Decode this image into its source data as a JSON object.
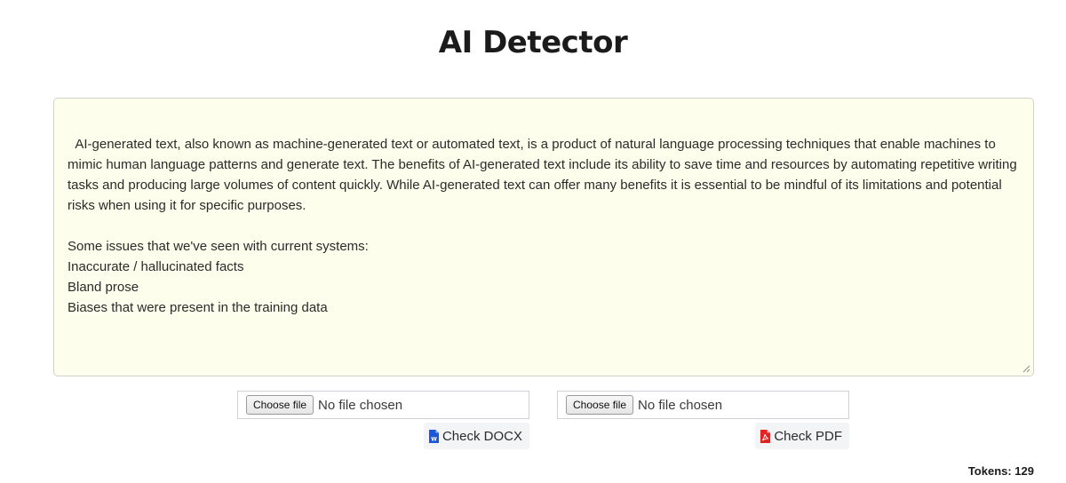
{
  "page": {
    "title": "AI Detector"
  },
  "editor": {
    "text": "AI-generated text, also known as machine-generated text or automated text, is a product of natural language processing techniques that enable machines to mimic human language patterns and generate text. The benefits of AI-generated text include its ability to save time and resources by automating repetitive writing tasks and producing large volumes of content quickly. While AI-generated text can offer many benefits it is essential to be mindful of its limitations and potential risks when using it for specific purposes.\n\nSome issues that we've seen with current systems:\nInaccurate / hallucinated facts\nBland prose\nBiases that were present in the training data",
    "background_color": "#fefeec"
  },
  "docx_upload": {
    "choose_label": "Choose file",
    "status": "No file chosen",
    "check_label": "Check DOCX",
    "icon": "word-file-icon",
    "icon_color": "#1a56db"
  },
  "pdf_upload": {
    "choose_label": "Choose file",
    "status": "No file chosen",
    "check_label": "Check PDF",
    "icon": "pdf-file-icon",
    "icon_color": "#e02424"
  },
  "tokens": {
    "label": "Tokens: 129"
  }
}
